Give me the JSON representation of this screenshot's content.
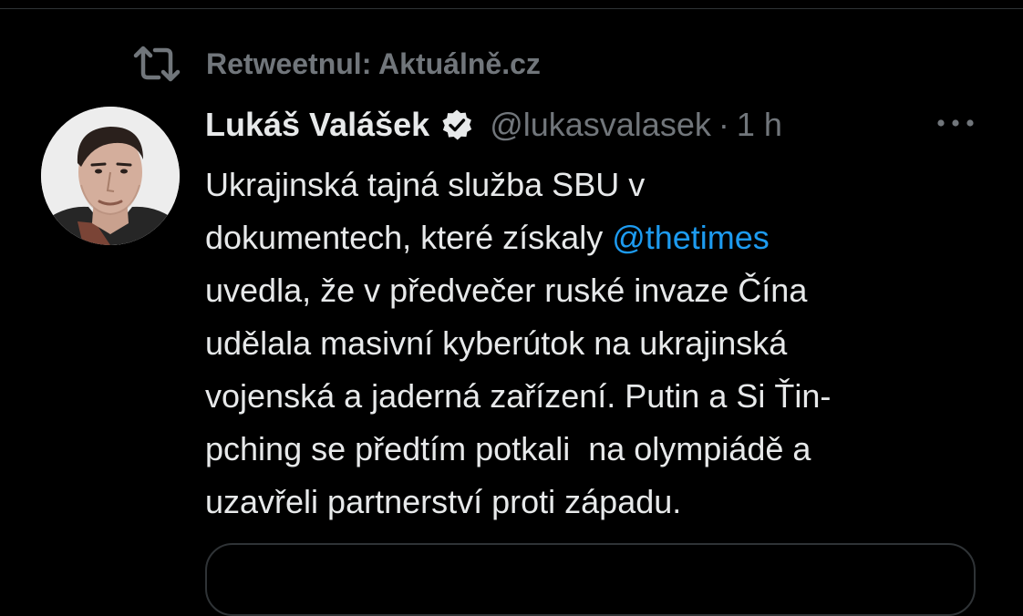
{
  "retweet": {
    "label": "Retweetnul: Aktuálně.cz",
    "icon": "retweet-icon"
  },
  "tweet": {
    "author_name": "Lukáš Valášek",
    "handle": "@lukasvalasek",
    "separator": "·",
    "time": "1 h",
    "verified": true,
    "more_icon": "more-horizontal-icon",
    "text_lines": {
      "l1": "Ukrajinská tajná služba SBU v",
      "l2_before": "dokumentech, které získaly ",
      "l2_mention": "@thetimes",
      "l3": "uvedla, že v předvečer ruské invaze Čína",
      "l4": "udělala masivní kyberútok na ukrajinská",
      "l5": "vojenská a jaderná zařízení. Putin a Si Ťin-",
      "l6": "pching se předtím potkali  na olympiádě a",
      "l7": "uzavřeli partnerství proti západu."
    }
  },
  "colors": {
    "background": "#000000",
    "primary_text": "#e7e9ea",
    "secondary_text": "#71767b",
    "link": "#1d9bf0",
    "divider": "#2f3336"
  }
}
